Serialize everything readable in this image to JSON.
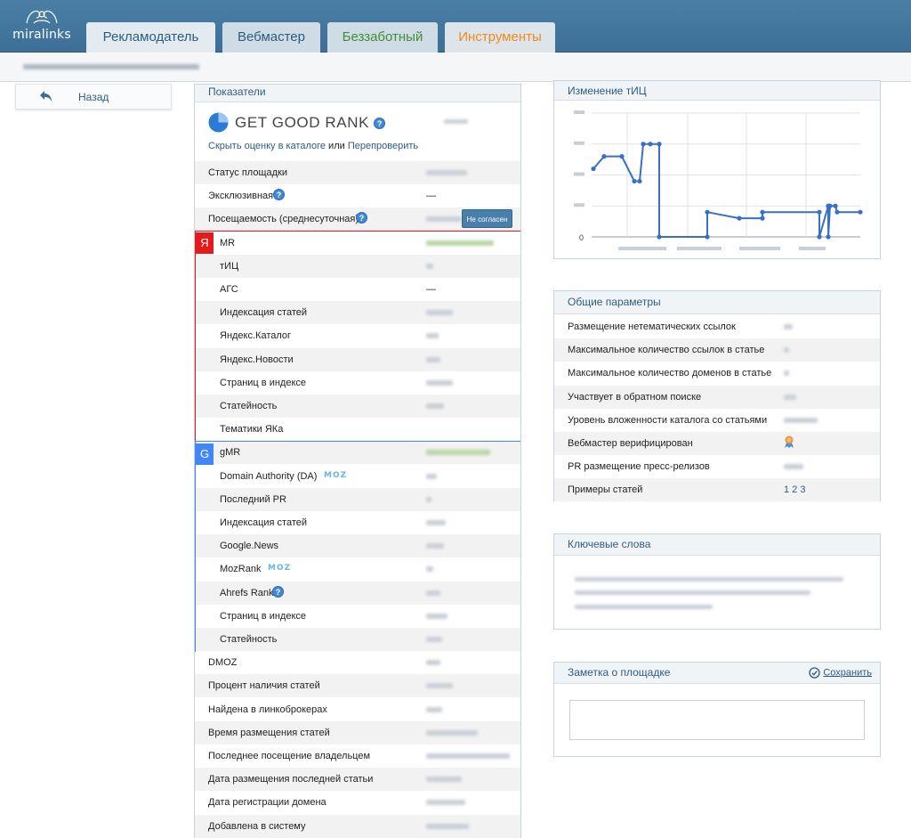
{
  "app": {
    "logo_text": "miralinks"
  },
  "tabs": [
    {
      "label": "Рекламодатель"
    },
    {
      "label": "Вебмастер"
    },
    {
      "label": "Беззаботный"
    },
    {
      "label": "Инструменты"
    }
  ],
  "colors": {
    "header": "#3d6f96",
    "yandex": "#e61a1a",
    "google": "#4285f4",
    "chart_line": "#3a6fc6",
    "tab_carefree": "#3f8f3a",
    "tab_tools": "#f08a1a"
  },
  "back": {
    "label": "Назад",
    "icon": "back-arrow-icon"
  },
  "indicators": {
    "title": "Показатели",
    "ggr_title": "GET GOOD RANK",
    "link_hide": "Скрыть оценку в каталоге",
    "link_or": " или ",
    "link_recheck": "Перепроверить",
    "disagree_button": "Не согласен",
    "rows": [
      {
        "label": "Статус площадки",
        "value": ""
      },
      {
        "label": "Эксклюзивная",
        "value": "—"
      },
      {
        "label": "Посещаемость (среднесуточная)",
        "value": ""
      },
      {
        "label": "MR",
        "value": ""
      },
      {
        "label": "тИЦ",
        "value": ""
      },
      {
        "label": "АГС",
        "value": "—"
      },
      {
        "label": "Индексация статей",
        "value": ""
      },
      {
        "label": "Яндекс.Каталог",
        "value": ""
      },
      {
        "label": "Яндекс.Новости",
        "value": ""
      },
      {
        "label": "Страниц в индексе",
        "value": ""
      },
      {
        "label": "Статейность",
        "value": ""
      },
      {
        "label": "Тематики ЯКа",
        "value": ""
      },
      {
        "label": "gMR",
        "value": ""
      },
      {
        "label": "Domain Authority (DA)",
        "value": ""
      },
      {
        "label": "Последний PR",
        "value": ""
      },
      {
        "label": "Индексация статей",
        "value": ""
      },
      {
        "label": "Google.News",
        "value": ""
      },
      {
        "label": "MozRank",
        "value": ""
      },
      {
        "label": "Ahrefs Rank",
        "value": ""
      },
      {
        "label": "Страниц в индексе",
        "value": ""
      },
      {
        "label": "Статейность",
        "value": ""
      },
      {
        "label": "DMOZ",
        "value": ""
      },
      {
        "label": "Процент наличия статей",
        "value": ""
      },
      {
        "label": "Найдена в линкоброкерах",
        "value": ""
      },
      {
        "label": "Время размещения статей",
        "value": ""
      },
      {
        "label": "Последнее посещение владельцем",
        "value": ""
      },
      {
        "label": "Дата размещения последней статьи",
        "value": ""
      },
      {
        "label": "Дата регистрации домена",
        "value": ""
      },
      {
        "label": "Добавлена в систему",
        "value": ""
      }
    ],
    "yandex_badge": "Я",
    "google_badge": "G",
    "moz_label": "MOZ"
  },
  "tic_chart": {
    "title": "Изменение тИЦ",
    "y_zero_label": "0"
  },
  "chart_data": {
    "type": "line",
    "title": "Изменение тИЦ",
    "y_ticks_visible": [
      "0"
    ],
    "ylim": [
      0,
      4
    ],
    "series": [
      {
        "values": [
          2.2,
          2.6,
          2.6,
          1.8,
          1.8,
          3.0,
          3.0,
          3.0,
          0,
          0,
          0.8,
          0.6,
          0.6,
          0.8,
          0.8,
          0,
          1.0,
          1.0,
          0,
          1.0,
          1.0,
          0.8,
          0.8
        ]
      }
    ]
  },
  "params": {
    "title": "Общие параметры",
    "rows": [
      {
        "label": "Размещение нетематических ссылок",
        "value": ""
      },
      {
        "label": "Максимальное количество ссылок в статье",
        "value": ""
      },
      {
        "label": "Максимальное количество доменов в статье",
        "value": ""
      },
      {
        "label": "Участвует в обратном поиске",
        "value": ""
      },
      {
        "label": "Уровень вложенности каталога со статьями",
        "value": ""
      },
      {
        "label": "Вебмастер верифицирован",
        "value": ""
      },
      {
        "label": "PR размещение пресс-релизов",
        "value": ""
      },
      {
        "label": "Примеры статей",
        "value": "1 2 3"
      }
    ]
  },
  "keywords": {
    "title": "Ключевые слова"
  },
  "note": {
    "title": "Заметка о площадке",
    "save_label": "Сохранить",
    "placeholder": ""
  }
}
